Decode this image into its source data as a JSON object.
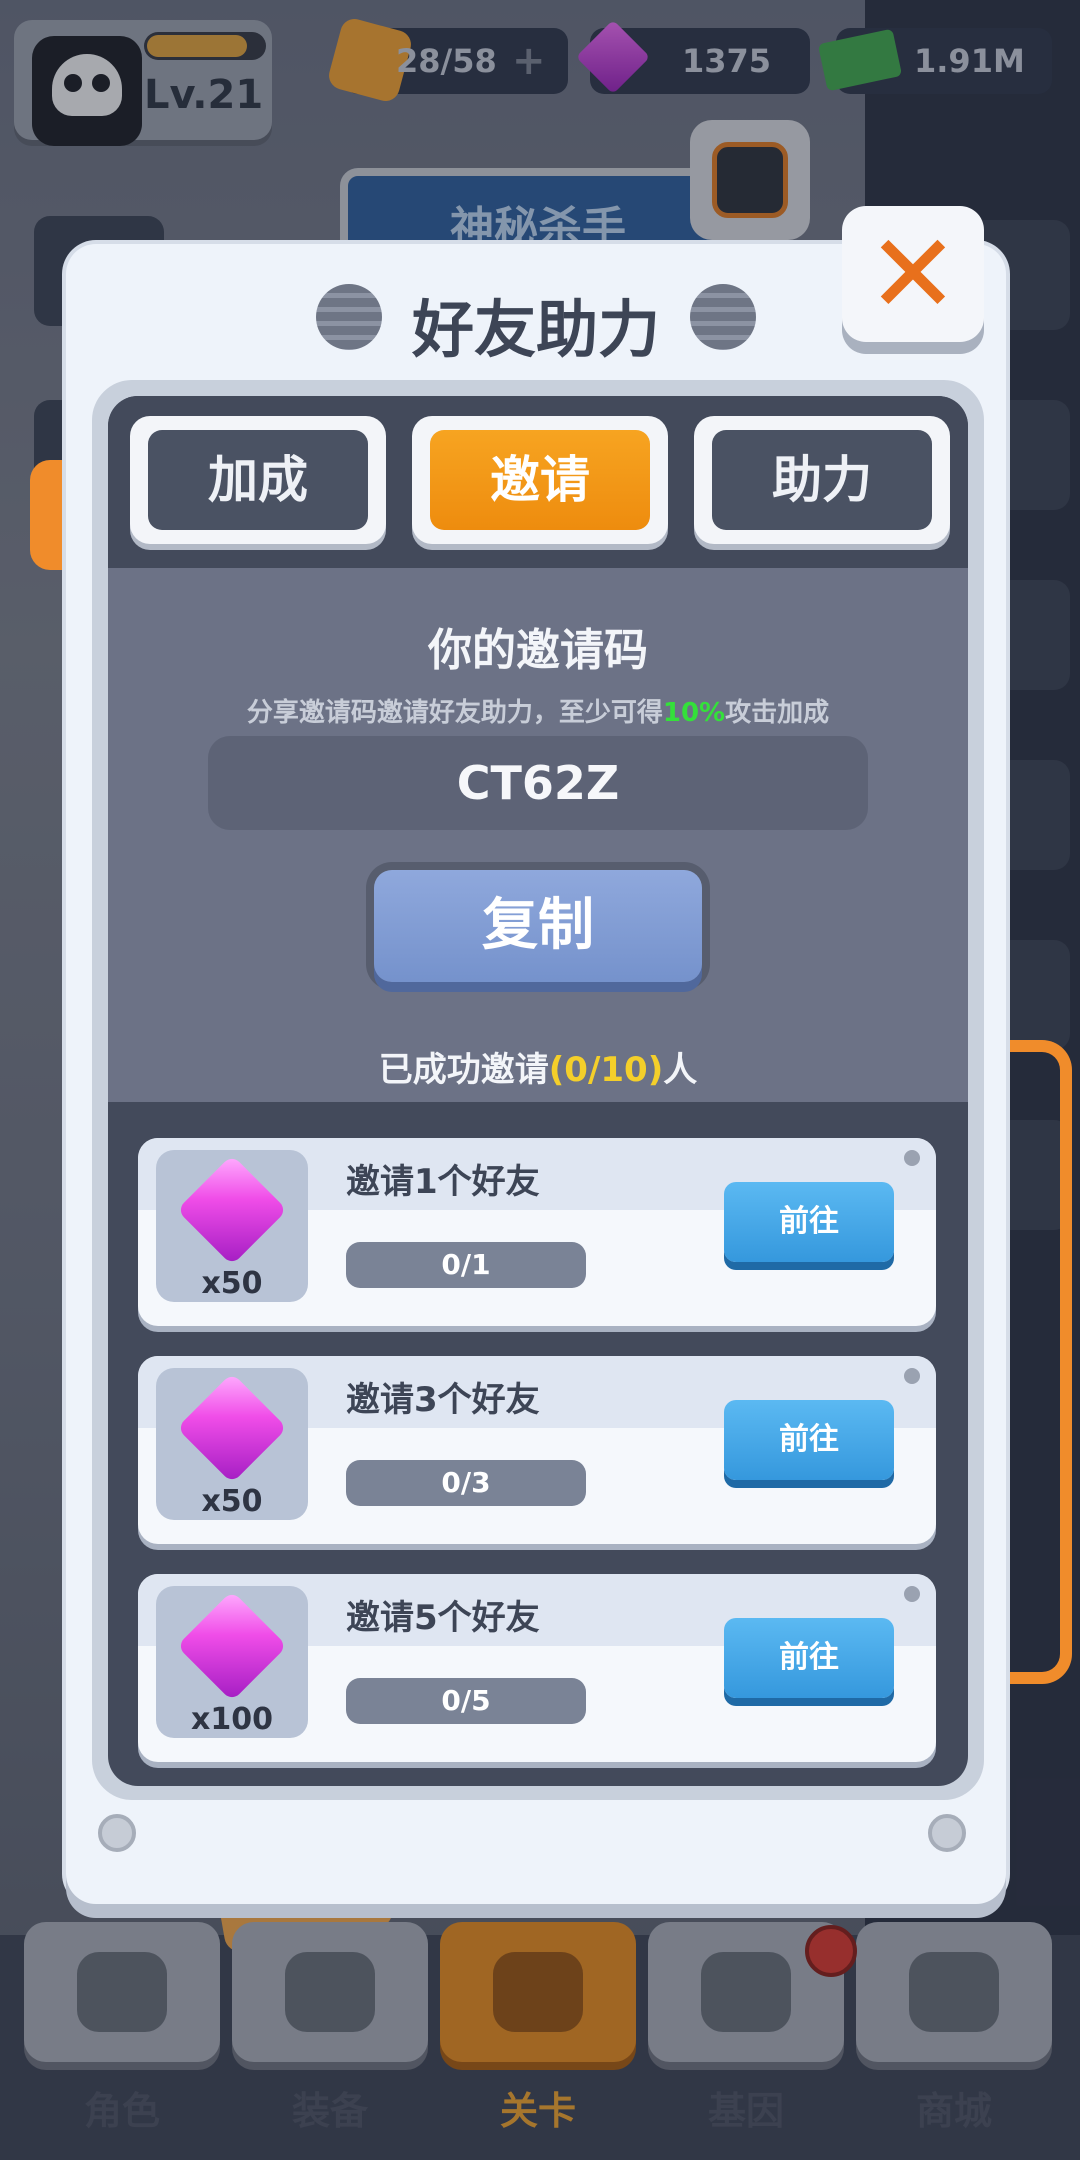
{
  "hud": {
    "level": "Lv.21",
    "energy": "28/58",
    "gems": "1375",
    "cash": "1.91M"
  },
  "background": {
    "banner_title": "神秘杀手"
  },
  "modal": {
    "title": "好友助力",
    "tabs": [
      {
        "label": "加成",
        "active": false
      },
      {
        "label": "邀请",
        "active": true
      },
      {
        "label": "助力",
        "active": false
      }
    ],
    "invite": {
      "heading": "你的邀请码",
      "desc_prefix": "分享邀请码邀请好友助力，至少可得",
      "desc_highlight": "10%",
      "desc_suffix": "攻击加成",
      "code": "CT62Z",
      "copy_label": "复制",
      "invited_prefix": "已成功邀请",
      "invited_count": "(0/10)",
      "invited_suffix": "人"
    },
    "tasks": [
      {
        "title": "邀请1个好友",
        "reward": "x50",
        "progress": "0/1",
        "fraction": 0,
        "button": "前往"
      },
      {
        "title": "邀请3个好友",
        "reward": "x50",
        "progress": "0/3",
        "fraction": 0,
        "button": "前往"
      },
      {
        "title": "邀请5个好友",
        "reward": "x100",
        "progress": "0/5",
        "fraction": 0,
        "button": "前往"
      }
    ]
  },
  "nav": [
    {
      "label": "角色",
      "icon": "skull-icon",
      "active": false
    },
    {
      "label": "装备",
      "icon": "equipment-icon",
      "active": false
    },
    {
      "label": "关卡",
      "icon": "map-pin-icon",
      "active": true
    },
    {
      "label": "基因",
      "icon": "hexagon-cluster-icon",
      "active": false
    },
    {
      "label": "商城",
      "icon": "shop-icon",
      "active": false
    }
  ],
  "colors": {
    "accent_orange": "#f08c2b",
    "tab_active": "#f7a421",
    "go_button": "#3598dd",
    "highlight_green": "#34e03a",
    "highlight_yellow": "#f4cf2a"
  }
}
